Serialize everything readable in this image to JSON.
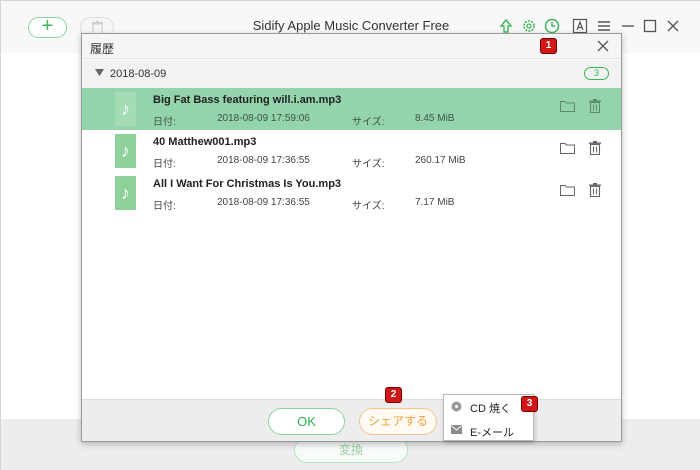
{
  "app": {
    "title": "Sidify Apple Music Converter Free",
    "add_label": "+",
    "convert_label": "変換",
    "toolbar_icons": [
      "upload-icon",
      "gear-icon",
      "clock-history-icon",
      "font-icon",
      "menu-icon",
      "minimize-icon",
      "maximize-icon",
      "close-icon"
    ]
  },
  "dialog": {
    "title": "履歴",
    "group": {
      "date": "2018-08-09",
      "count": "3"
    },
    "date_label": "日付:",
    "size_label": "サイズ:",
    "tracks": [
      {
        "name": "Big Fat Bass featuring will.i.am.mp3",
        "date": "2018-08-09 17:59:06",
        "size": "8.45 MiB",
        "selected": true
      },
      {
        "name": "40 Matthew001.mp3",
        "date": "2018-08-09 17:36:55",
        "size": "260.17 MiB",
        "selected": false
      },
      {
        "name": "All I Want For Christmas Is You.mp3",
        "date": "2018-08-09 17:36:55",
        "size": "7.17 MiB",
        "selected": false
      }
    ],
    "ok_label": "OK",
    "share_label": "シェアする"
  },
  "share_menu": {
    "items": [
      {
        "label": "CD 焼く",
        "icon": "cd-icon"
      },
      {
        "label": "E-メール",
        "icon": "mail-icon"
      }
    ]
  },
  "badges": [
    "1",
    "2",
    "3"
  ],
  "colors": {
    "accent_green": "#3cb65a",
    "selected_row": "#93d4ad",
    "share_orange": "#f0a13b",
    "badge_red": "#d01818"
  }
}
